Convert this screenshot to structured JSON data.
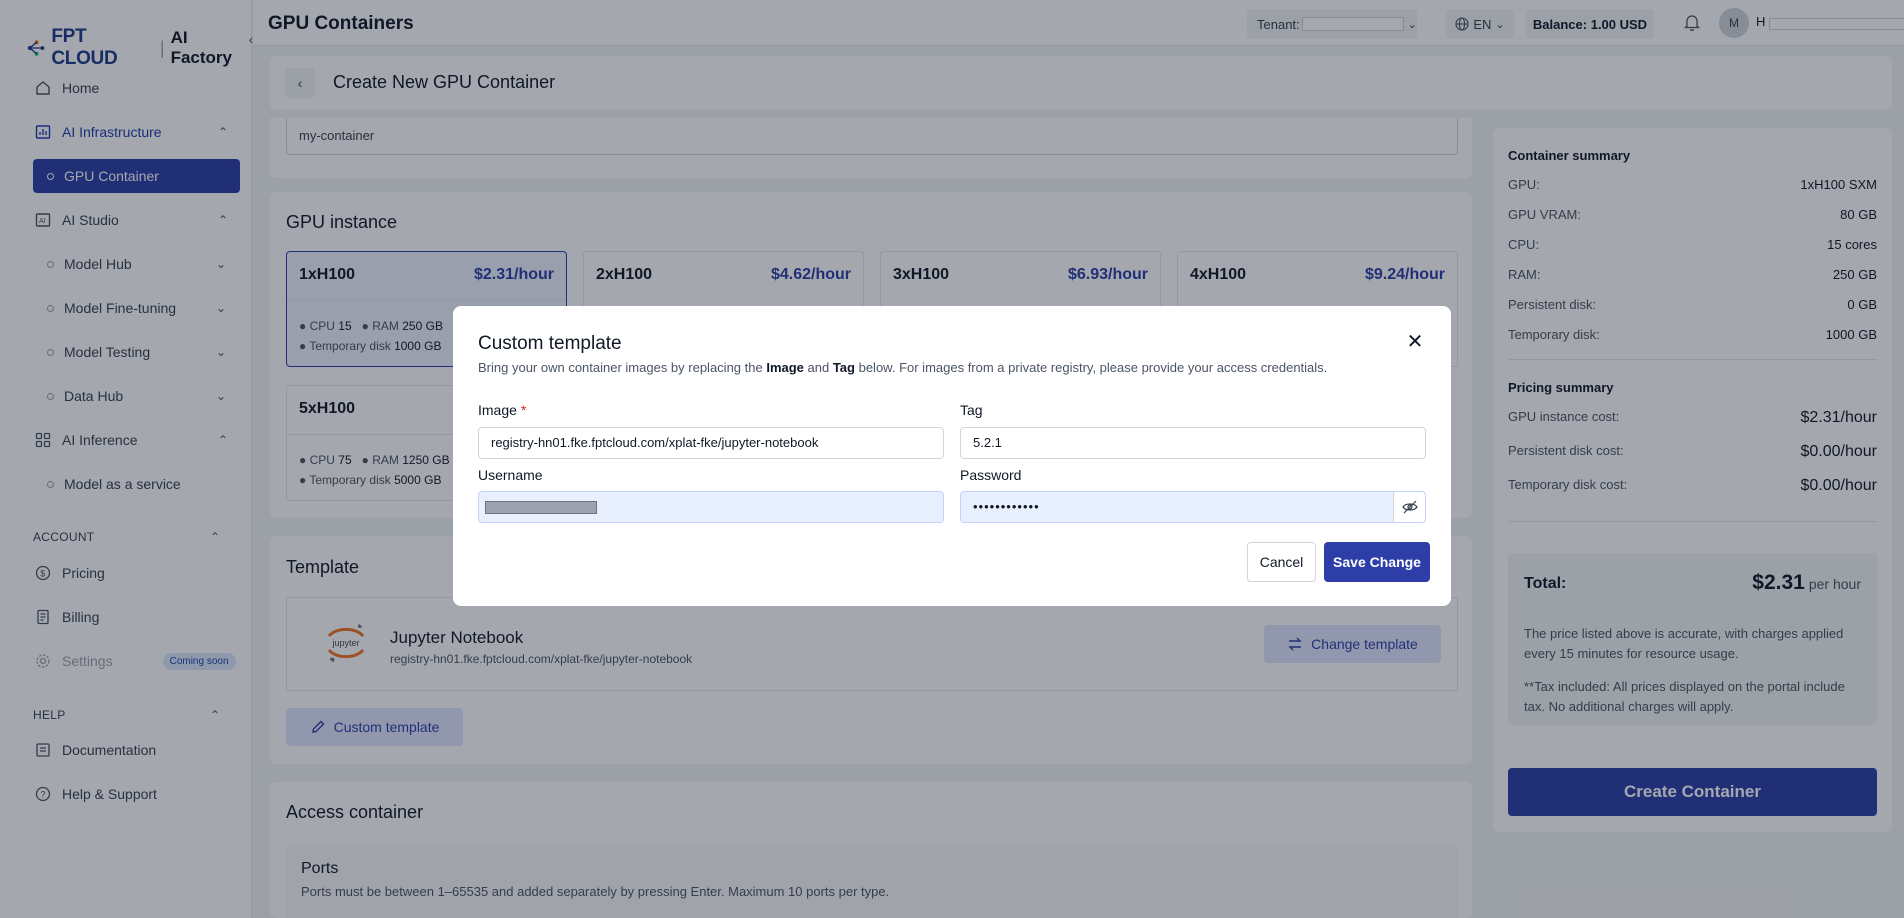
{
  "sidebar": {
    "logo_brand": "FPT CLOUD",
    "logo_product": "AI Factory",
    "items": {
      "home": "Home",
      "ai_infrastructure": "AI Infrastructure",
      "gpu_container": "GPU Container",
      "ai_studio": "AI Studio",
      "model_hub": "Model Hub",
      "model_fine_tuning": "Model Fine-tuning",
      "model_testing": "Model Testing",
      "data_hub": "Data Hub",
      "ai_inference": "AI Inference",
      "model_as_a_service": "Model as a service",
      "pricing": "Pricing",
      "billing": "Billing",
      "settings": "Settings",
      "settings_badge": "Coming soon",
      "documentation": "Documentation",
      "help_support": "Help & Support"
    },
    "sections": {
      "account": "ACCOUNT",
      "help": "HELP"
    }
  },
  "header": {
    "title": "GPU Containers",
    "tenant_label": "Tenant:",
    "language": "EN",
    "balance": "Balance: 1.00 USD",
    "avatar_initial": "M",
    "user_initial": "H"
  },
  "subheader": {
    "title": "Create New GPU Container"
  },
  "main": {
    "container_name": "my-container",
    "gpu_section_title": "GPU instance",
    "gpu_options": [
      {
        "name": "1xH100",
        "price": "$2.31/hour",
        "cpu_label": "CPU",
        "cpu": "15",
        "ram_label": "RAM",
        "ram": "250 GB",
        "disk_label": "Temporary disk",
        "disk": "1000 GB"
      },
      {
        "name": "2xH100",
        "price": "$4.62/hour"
      },
      {
        "name": "3xH100",
        "price": "$6.93/hour"
      },
      {
        "name": "4xH100",
        "price": "$9.24/hour"
      },
      {
        "name": "5xH100",
        "cpu_label": "CPU",
        "cpu": "75",
        "ram_label": "RAM",
        "ram": "1250 GB",
        "disk_label": "Temporary disk",
        "disk": "5000 GB"
      }
    ],
    "template_section_title": "Template",
    "template_name": "Jupyter Notebook",
    "template_image": "registry-hn01.fke.fptcloud.com/xplat-fke/jupyter-notebook",
    "template_logo_text": "jupyter",
    "change_template_label": "Change template",
    "custom_template_label": "Custom template",
    "access_section_title": "Access container",
    "ports_title": "Ports",
    "ports_desc": "Ports must be between 1–65535 and added separately by pressing Enter. Maximum 10 ports per type."
  },
  "summary": {
    "container_title": "Container summary",
    "rows": [
      {
        "label": "GPU:",
        "value": "1xH100 SXM"
      },
      {
        "label": "GPU VRAM:",
        "value": "80 GB"
      },
      {
        "label": "CPU:",
        "value": "15 cores"
      },
      {
        "label": "RAM:",
        "value": "250 GB"
      },
      {
        "label": "Persistent disk:",
        "value": "0 GB"
      },
      {
        "label": "Temporary disk:",
        "value": "1000 GB"
      }
    ],
    "pricing_title": "Pricing summary",
    "price_rows": [
      {
        "label": "GPU instance cost:",
        "value": "$2.31/hour"
      },
      {
        "label": "Persistent disk cost:",
        "value": "$0.00/hour"
      },
      {
        "label": "Temporary disk cost:",
        "value": "$0.00/hour"
      }
    ],
    "total_label": "Total:",
    "total_value": "$2.31",
    "total_unit": "per hour",
    "note1": "The price listed above is accurate, with charges applied every 15 minutes for resource usage.",
    "note2": "**Tax included: All prices displayed on the portal include tax. No additional charges will apply.",
    "create_button": "Create Container"
  },
  "modal": {
    "title": "Custom template",
    "desc_pre": "Bring your own container images by replacing the ",
    "desc_image": "Image",
    "desc_and": " and ",
    "desc_tag": "Tag",
    "desc_post": " below. For images from a private registry, please provide your access credentials.",
    "image_label": "Image",
    "image_required": "*",
    "image_value": "registry-hn01.fke.fptcloud.com/xplat-fke/jupyter-notebook",
    "tag_label": "Tag",
    "tag_value": "5.2.1",
    "username_label": "Username",
    "password_label": "Password",
    "password_value": "••••••••••••",
    "cancel_label": "Cancel",
    "save_label": "Save Change"
  },
  "colors": {
    "primary": "#2d3ea8",
    "accent_light": "#e0e7ff",
    "required": "#dc2626"
  }
}
